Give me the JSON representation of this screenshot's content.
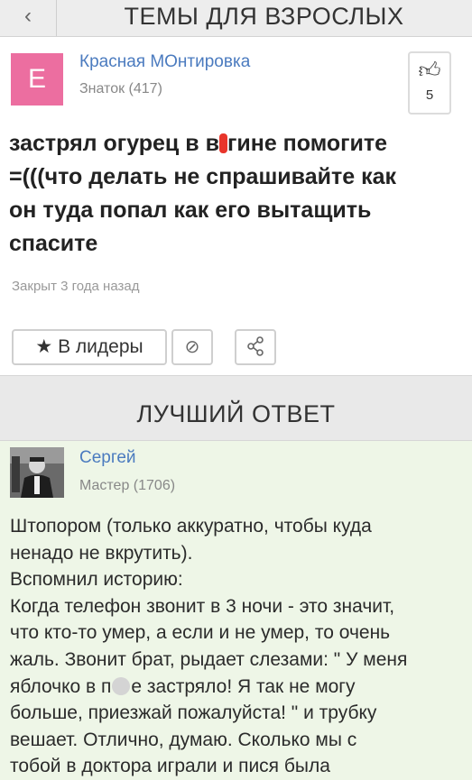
{
  "header": {
    "back_icon": "chevron-left",
    "title": "ТЕМЫ ДЛЯ ВЗРОСЛЫХ"
  },
  "question": {
    "author": {
      "initial": "Е",
      "name": "Красная МОнтировка",
      "rank": "Знаток (417)",
      "avatar_color": "#ec6ea0"
    },
    "likes": {
      "icon": "thumbs-up",
      "count": "5"
    },
    "text_lines": [
      "застрял огурец в в",
      "гине помогите",
      "=(((что делать не спрашивайте как",
      "он туда попал как его вытащить",
      "спасите"
    ],
    "status": "Закрыт 3 года назад",
    "actions": {
      "leaders_icon": "star",
      "leaders_label": "В лидеры",
      "block_icon": "block",
      "share_icon": "share"
    }
  },
  "best_answer": {
    "header": "ЛУЧШИЙ ОТВЕТ",
    "author": {
      "name": "Сергей",
      "rank": "Мастер (1706)"
    },
    "text_lines": [
      "Штопором (только аккуратно, чтобы куда",
      "ненадо не вкрутить).",
      "Вспомнил историю:",
      "Когда телефон звонит в 3 ночи - это значит,",
      "что кто-то умер, а если и не умер, то очень",
      "жаль. Звонит брат, рыдает слезами: \" У меня",
      "яблочко в п",
      "е застряло! Я так не могу",
      "больше, приезжай пожалуйста! \" и трубку",
      "вешает. Отлично, думаю. Сколько мы с",
      "тобой в доктора играли и пися была"
    ]
  }
}
